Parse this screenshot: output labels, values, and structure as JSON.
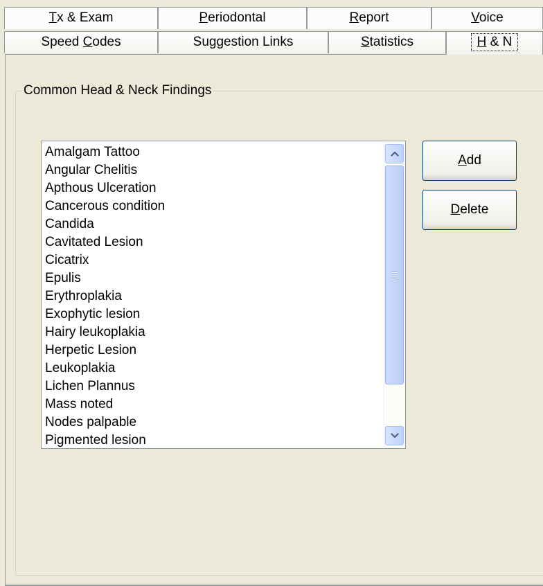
{
  "tabs_back": [
    {
      "pre": "",
      "mn": "T",
      "post": "x & Exam"
    },
    {
      "pre": "",
      "mn": "P",
      "post": "eriodontal"
    },
    {
      "pre": "",
      "mn": "R",
      "post": "eport"
    },
    {
      "pre": "",
      "mn": "V",
      "post": "oice"
    }
  ],
  "tabs_front": [
    {
      "pre": "Speed ",
      "mn": "C",
      "post": "odes"
    },
    {
      "pre": "Suggestion Links",
      "mn": "",
      "post": ""
    },
    {
      "pre": "",
      "mn": "S",
      "post": "tatistics"
    },
    {
      "pre": "",
      "mn": "H",
      "post": " & N"
    }
  ],
  "groupbox": {
    "label": "Common Head & Neck Findings"
  },
  "findings_list": [
    "Amalgam Tattoo",
    "Angular Chelitis",
    "Apthous Ulceration",
    "Cancerous condition",
    "Candida",
    "Cavitated Lesion",
    "Cicatrix",
    "Epulis",
    "Erythroplakia",
    "Exophytic lesion",
    "Hairy leukoplakia",
    "Herpetic Lesion",
    "Leukoplakia",
    "Lichen Plannus",
    "Mass noted",
    "Nodes palpable",
    "Pigmented lesion"
  ],
  "buttons": {
    "add": {
      "pre": "",
      "mn": "A",
      "post": "dd"
    },
    "delete": {
      "pre": "",
      "mn": "D",
      "post": "elete"
    }
  },
  "scrollbar": {
    "up_icon": "scroll-up-arrow-icon",
    "down_icon": "scroll-down-arrow-icon",
    "accent": "#4d6185"
  }
}
